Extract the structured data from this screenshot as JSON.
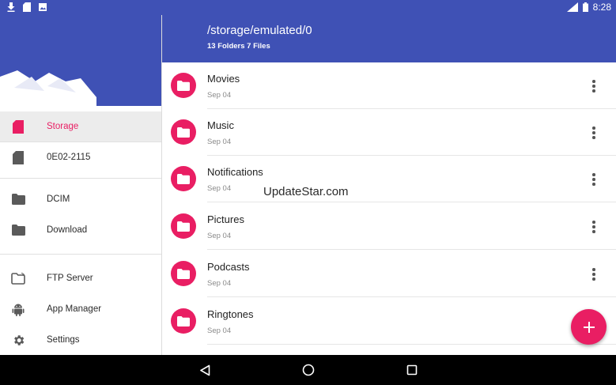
{
  "status_bar": {
    "time": "8:28",
    "icons": [
      "download-icon",
      "sd-card-icon",
      "image-icon",
      "signal-icon",
      "battery-icon"
    ]
  },
  "drawer": {
    "items": [
      {
        "label": "Storage",
        "icon": "sd-card-icon",
        "active": true
      },
      {
        "label": "0E02-2115",
        "icon": "sd-card-icon",
        "active": false
      },
      {
        "label": "DCIM",
        "icon": "folder-icon",
        "active": false
      },
      {
        "label": "Download",
        "icon": "folder-icon",
        "active": false
      },
      {
        "label": "FTP Server",
        "icon": "ftp-folder-icon",
        "active": false
      },
      {
        "label": "App Manager",
        "icon": "android-icon",
        "active": false
      },
      {
        "label": "Settings",
        "icon": "gear-icon",
        "active": false
      }
    ]
  },
  "appbar": {
    "path": "/storage/emulated/0",
    "counts": "13 Folders 7 Files"
  },
  "files": [
    {
      "name": "Movies",
      "date": "Sep 04"
    },
    {
      "name": "Music",
      "date": "Sep 04"
    },
    {
      "name": "Notifications",
      "date": "Sep 04"
    },
    {
      "name": "Pictures",
      "date": "Sep 04"
    },
    {
      "name": "Podcasts",
      "date": "Sep 04"
    },
    {
      "name": "Ringtones",
      "date": "Sep 04"
    }
  ],
  "watermark": "UpdateStar.com",
  "colors": {
    "primary": "#3f51b5",
    "accent": "#e91e63"
  }
}
